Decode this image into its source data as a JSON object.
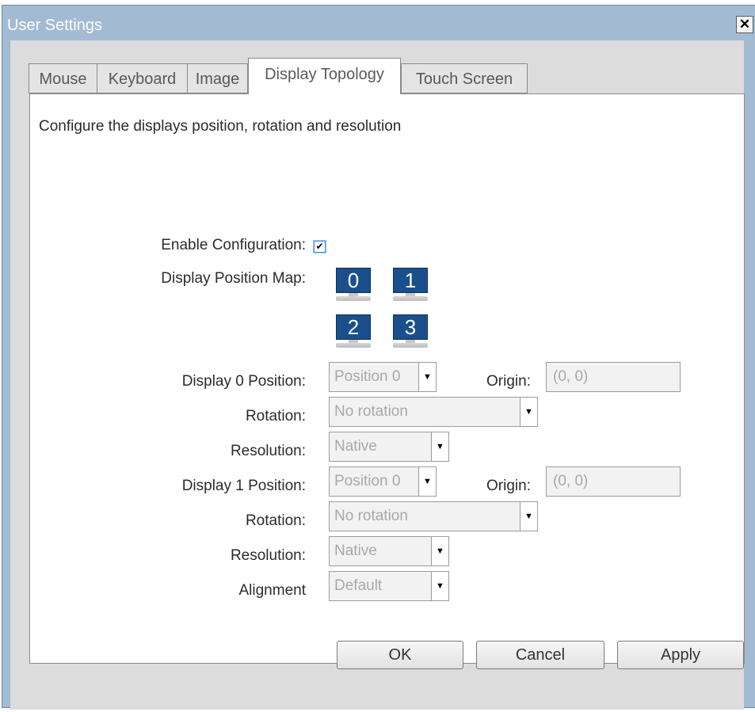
{
  "window": {
    "title": "User Settings",
    "close_glyph": "✕"
  },
  "tabs": [
    {
      "label": "Mouse"
    },
    {
      "label": "Keyboard"
    },
    {
      "label": "Image"
    },
    {
      "label": "Display Topology",
      "active": true
    },
    {
      "label": "Touch Screen"
    }
  ],
  "content": {
    "description": "Configure the displays position, rotation and resolution",
    "enable_label": "Enable Configuration:",
    "enable_checked": true,
    "check_glyph": "✔",
    "map_label": "Display Position Map:",
    "monitors": [
      "0",
      "1",
      "2",
      "3"
    ],
    "display0": {
      "position_label": "Display 0 Position:",
      "position_value": "Position 0",
      "origin_label": "Origin:",
      "origin_value": "(0, 0)",
      "rotation_label": "Rotation:",
      "rotation_value": "No rotation",
      "resolution_label": "Resolution:",
      "resolution_value": "Native"
    },
    "display1": {
      "position_label": "Display 1 Position:",
      "position_value": "Position 0",
      "origin_label": "Origin:",
      "origin_value": "(0, 0)",
      "rotation_label": "Rotation:",
      "rotation_value": "No rotation",
      "resolution_label": "Resolution:",
      "resolution_value": "Native"
    },
    "alignment_label": "Alignment",
    "alignment_value": "Default",
    "dropdown_glyph": "▼"
  },
  "buttons": {
    "ok": "OK",
    "cancel": "Cancel",
    "apply": "Apply"
  },
  "colors": {
    "titlebar": "#a3bad3",
    "monitor": "#1b4f8c",
    "focus": "#3a8ee6"
  }
}
